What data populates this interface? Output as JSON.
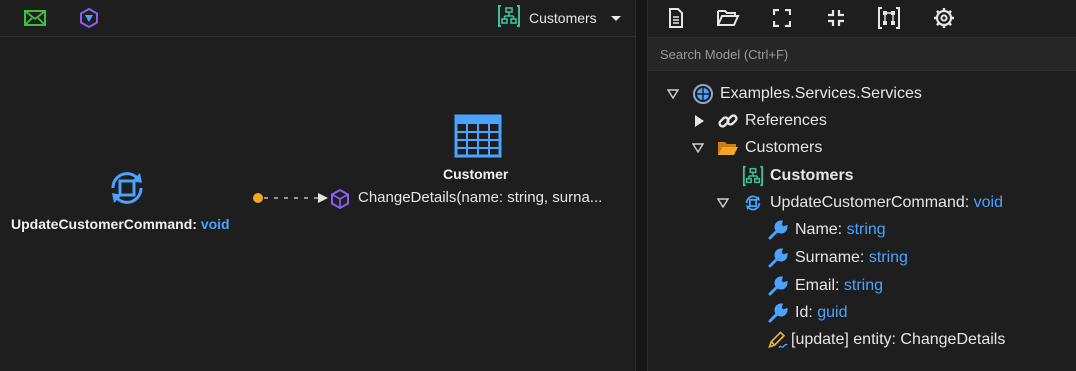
{
  "left_toolbar": {
    "diagram_name": "Customers"
  },
  "diagram": {
    "command_node": {
      "name": "UpdateCustomerCommand",
      "separator": ":",
      "return_type": "void"
    },
    "entity_node": {
      "name": "Customer"
    },
    "association": {
      "operation": "ChangeDetails(name: string, surna..."
    }
  },
  "search": {
    "placeholder": "Search Model (Ctrl+F)"
  },
  "tree": {
    "root": {
      "label": "Examples.Services.Services"
    },
    "references": {
      "label": "References"
    },
    "folder": {
      "label": "Customers"
    },
    "diagram_item": {
      "label": "Customers"
    },
    "command": {
      "name": "UpdateCustomerCommand:",
      "type": "void"
    },
    "properties": [
      {
        "name": "Name:",
        "type": "string"
      },
      {
        "name": "Surname:",
        "type": "string"
      },
      {
        "name": "Email:",
        "type": "string"
      },
      {
        "name": "Id:",
        "type": "guid"
      }
    ],
    "mapping": {
      "label": "[update] entity: ChangeDetails"
    }
  },
  "colors": {
    "accent_blue": "#4aa3ff",
    "icon_green": "#3fbf7f",
    "icon_purple": "#8b5cf6",
    "folder_orange": "#f5a623",
    "background": "#1e1e1e"
  }
}
